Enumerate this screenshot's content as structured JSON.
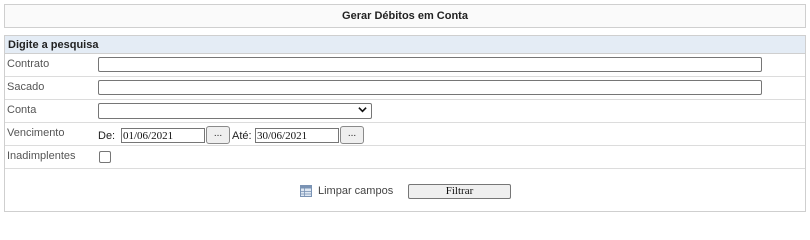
{
  "page": {
    "title": "Gerar Débitos em Conta"
  },
  "panel": {
    "header": "Digite a pesquisa"
  },
  "fields": {
    "contrato": {
      "label": "Contrato",
      "value": ""
    },
    "sacado": {
      "label": "Sacado",
      "value": ""
    },
    "conta": {
      "label": "Conta",
      "selected": ""
    },
    "vencimento": {
      "label": "Vencimento",
      "from_label": "De:",
      "from_value": "01/06/2021",
      "to_label": "Até:",
      "to_value": "30/06/2021",
      "picker_label": "..."
    },
    "inadimplentes": {
      "label": "Inadimplentes",
      "checked": false
    }
  },
  "actions": {
    "clear_label": "Limpar campos",
    "filter_label": "Filtrar"
  },
  "icons": {
    "clear": "eraser-table-icon",
    "select": "chevron-down-icon"
  },
  "colors": {
    "header_bg": "#e4ecf5",
    "border": "#cfcfcf"
  }
}
